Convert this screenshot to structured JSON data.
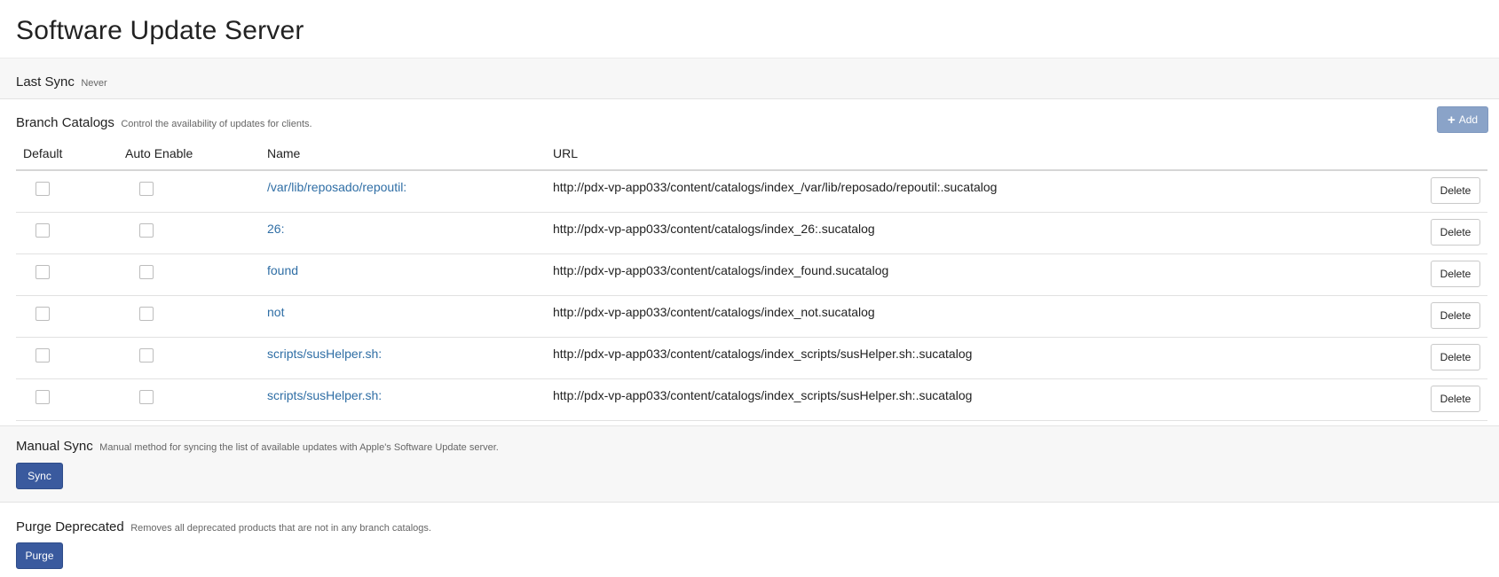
{
  "page": {
    "title": "Software Update Server"
  },
  "last_sync": {
    "label": "Last Sync",
    "value": "Never"
  },
  "branch_catalogs": {
    "label": "Branch Catalogs",
    "help": "Control the availability of updates for clients.",
    "add_label": "Add",
    "add_icon": "plus-icon",
    "columns": {
      "default": "Default",
      "auto_enable": "Auto Enable",
      "name": "Name",
      "url": "URL"
    },
    "rows": [
      {
        "name": "/var/lib/reposado/repoutil:",
        "url": "http://pdx-vp-app033/content/catalogs/index_/var/lib/reposado/repoutil:.sucatalog",
        "default": false,
        "auto_enable": false,
        "delete_label": "Delete"
      },
      {
        "name": "26:",
        "url": "http://pdx-vp-app033/content/catalogs/index_26:.sucatalog",
        "default": false,
        "auto_enable": false,
        "delete_label": "Delete"
      },
      {
        "name": "found",
        "url": "http://pdx-vp-app033/content/catalogs/index_found.sucatalog",
        "default": false,
        "auto_enable": false,
        "delete_label": "Delete"
      },
      {
        "name": "not",
        "url": "http://pdx-vp-app033/content/catalogs/index_not.sucatalog",
        "default": false,
        "auto_enable": false,
        "delete_label": "Delete"
      },
      {
        "name": "scripts/susHelper.sh:",
        "url": "http://pdx-vp-app033/content/catalogs/index_scripts/susHelper.sh:.sucatalog",
        "default": false,
        "auto_enable": false,
        "delete_label": "Delete"
      },
      {
        "name": "scripts/susHelper.sh:",
        "url": "http://pdx-vp-app033/content/catalogs/index_scripts/susHelper.sh:.sucatalog",
        "default": false,
        "auto_enable": false,
        "delete_label": "Delete"
      }
    ]
  },
  "manual_sync": {
    "label": "Manual Sync",
    "help": "Manual method for syncing the list of available updates with Apple's Software Update server.",
    "button_label": "Sync"
  },
  "purge_deprecated": {
    "label": "Purge Deprecated",
    "help": "Removes all deprecated products that are not in any branch catalogs.",
    "button_label": "Purge"
  },
  "colors": {
    "primary_button": "#3a5a9e",
    "add_button": "#8aa3c8",
    "link": "#2f6ea5",
    "section_background": "#f7f7f7"
  }
}
